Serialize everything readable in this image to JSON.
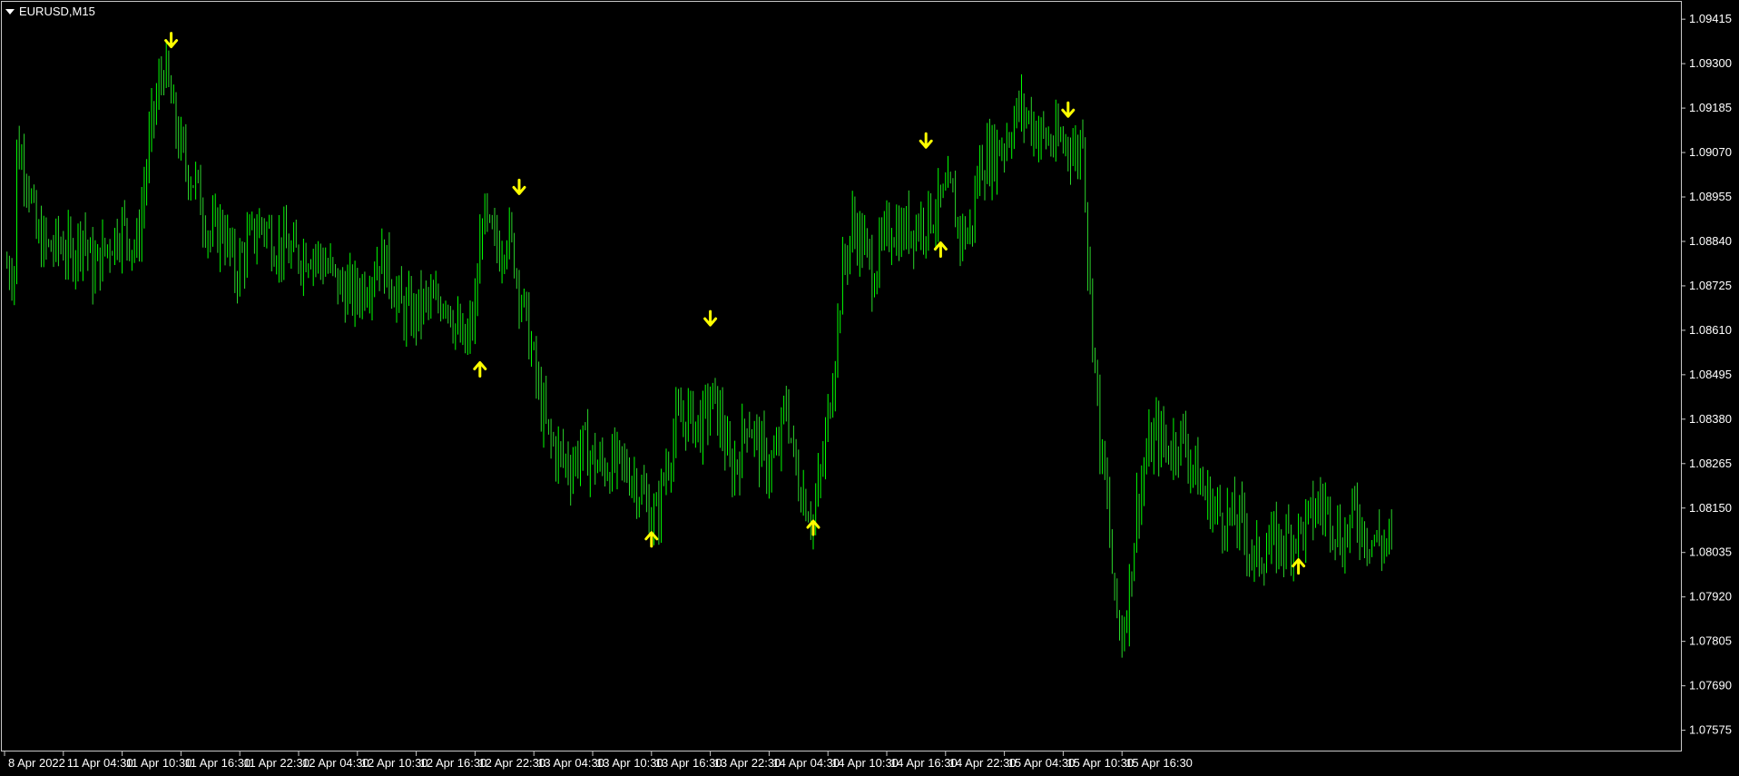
{
  "symbol": {
    "label": "EURUSD,M15",
    "menu_icon": "chevron-down-icon"
  },
  "colors": {
    "background": "#000000",
    "bull": "#00ff00",
    "bear": "#2bd52b",
    "arrow": "#ffff00",
    "axis": "#c8c8c8",
    "text": "#ffffff"
  },
  "chart_data": {
    "type": "candlestick",
    "title": "EURUSD,M15",
    "xlabel": "",
    "ylabel": "",
    "grid": false,
    "ylim": [
      1.0752,
      1.0946
    ],
    "y_ticks": [
      "1.09415",
      "1.09300",
      "1.09185",
      "1.09070",
      "1.08955",
      "1.08840",
      "1.08725",
      "1.08610",
      "1.08495",
      "1.08380",
      "1.08265",
      "1.08150",
      "1.08035",
      "1.07920",
      "1.07805",
      "1.07690",
      "1.07575"
    ],
    "x_ticks": [
      "8 Apr 2022",
      "11 Apr 04:30",
      "11 Apr 10:30",
      "11 Apr 16:30",
      "11 Apr 22:30",
      "12 Apr 04:30",
      "12 Apr 10:30",
      "12 Apr 16:30",
      "12 Apr 22:30",
      "13 Apr 04:30",
      "13 Apr 10:30",
      "13 Apr 16:30",
      "13 Apr 22:30",
      "14 Apr 04:30",
      "14 Apr 10:30",
      "14 Apr 16:30",
      "14 Apr 22:30",
      "15 Apr 04:30",
      "15 Apr 10:30",
      "15 Apr 16:30"
    ],
    "bars_per_tick": 24,
    "close_path": [
      [
        0,
        1.0878
      ],
      [
        4,
        1.0877
      ],
      [
        5,
        1.0908
      ],
      [
        9,
        1.0903
      ],
      [
        13,
        1.0885
      ],
      [
        18,
        1.0882
      ],
      [
        24,
        1.0883
      ],
      [
        27,
        1.088
      ],
      [
        32,
        1.0887
      ],
      [
        36,
        1.0876
      ],
      [
        42,
        1.0883
      ],
      [
        48,
        1.0888
      ],
      [
        54,
        1.0882
      ],
      [
        60,
        1.0914
      ],
      [
        65,
        1.093
      ],
      [
        69,
        1.0916
      ],
      [
        73,
        1.0905
      ],
      [
        78,
        1.0899
      ],
      [
        84,
        1.0885
      ],
      [
        89,
        1.0888
      ],
      [
        94,
        1.0876
      ],
      [
        99,
        1.0883
      ],
      [
        105,
        1.0889
      ],
      [
        110,
        1.0884
      ],
      [
        118,
        1.088
      ],
      [
        125,
        1.0882
      ],
      [
        132,
        1.0877
      ],
      [
        137,
        1.0872
      ],
      [
        143,
        1.087
      ],
      [
        148,
        1.0874
      ],
      [
        153,
        1.088
      ],
      [
        157,
        1.0876
      ],
      [
        162,
        1.0866
      ],
      [
        167,
        1.0865
      ],
      [
        172,
        1.0868
      ],
      [
        176,
        1.0867
      ],
      [
        180,
        1.0871
      ],
      [
        185,
        1.086
      ],
      [
        188,
        1.0856
      ],
      [
        192,
        1.0866
      ],
      [
        195,
        1.0891
      ],
      [
        198,
        1.0885
      ],
      [
        202,
        1.0882
      ],
      [
        205,
        1.0887
      ],
      [
        208,
        1.088
      ],
      [
        212,
        1.0866
      ],
      [
        215,
        1.0856
      ],
      [
        218,
        1.0844
      ],
      [
        222,
        1.0833
      ],
      [
        226,
        1.0829
      ],
      [
        231,
        1.0826
      ],
      [
        236,
        1.0831
      ],
      [
        242,
        1.0826
      ],
      [
        250,
        1.0826
      ],
      [
        256,
        1.0824
      ],
      [
        262,
        1.0816
      ],
      [
        266,
        1.0812
      ],
      [
        270,
        1.0826
      ],
      [
        274,
        1.0836
      ],
      [
        279,
        1.0839
      ],
      [
        284,
        1.0836
      ],
      [
        289,
        1.0843
      ],
      [
        293,
        1.0836
      ],
      [
        296,
        1.0824
      ],
      [
        300,
        1.0829
      ],
      [
        303,
        1.0839
      ],
      [
        307,
        1.0832
      ],
      [
        311,
        1.0826
      ],
      [
        315,
        1.0828
      ],
      [
        319,
        1.0842
      ],
      [
        323,
        1.0824
      ],
      [
        327,
        1.0817
      ],
      [
        330,
        1.0812
      ],
      [
        334,
        1.0827
      ],
      [
        338,
        1.085
      ],
      [
        342,
        1.0876
      ],
      [
        346,
        1.0888
      ],
      [
        350,
        1.0884
      ],
      [
        354,
        1.0876
      ],
      [
        358,
        1.0882
      ],
      [
        362,
        1.0888
      ],
      [
        366,
        1.0886
      ],
      [
        370,
        1.0888
      ],
      [
        374,
        1.0889
      ],
      [
        380,
        1.0892
      ],
      [
        386,
        1.0896
      ],
      [
        390,
        1.0886
      ],
      [
        394,
        1.0886
      ],
      [
        398,
        1.0904
      ],
      [
        402,
        1.0906
      ],
      [
        408,
        1.091
      ],
      [
        414,
        1.0918
      ],
      [
        418,
        1.0916
      ],
      [
        422,
        1.0912
      ],
      [
        428,
        1.0909
      ],
      [
        434,
        1.091
      ],
      [
        438,
        1.0906
      ],
      [
        440,
        1.0915
      ],
      [
        442,
        1.088
      ],
      [
        444,
        1.0862
      ],
      [
        447,
        1.0832
      ],
      [
        450,
        1.0816
      ],
      [
        453,
        1.079
      ],
      [
        456,
        1.0782
      ],
      [
        459,
        1.0795
      ],
      [
        462,
        1.0815
      ],
      [
        466,
        1.0828
      ],
      [
        470,
        1.0834
      ],
      [
        475,
        1.083
      ],
      [
        480,
        1.0834
      ],
      [
        485,
        1.0826
      ],
      [
        490,
        1.0818
      ],
      [
        495,
        1.0814
      ],
      [
        500,
        1.0812
      ],
      [
        505,
        1.0811
      ],
      [
        510,
        1.0801
      ],
      [
        514,
        1.0804
      ],
      [
        520,
        1.0806
      ],
      [
        526,
        1.0808
      ],
      [
        531,
        1.081
      ],
      [
        536,
        1.0816
      ],
      [
        541,
        1.0814
      ],
      [
        546,
        1.0806
      ],
      [
        551,
        1.0814
      ],
      [
        556,
        1.0808
      ],
      [
        561,
        1.0806
      ],
      [
        566,
        1.0806
      ]
    ],
    "signals": [
      {
        "bar": 68,
        "type": "sell",
        "price": 1.0936
      },
      {
        "bar": 194,
        "type": "buy",
        "price": 1.0851
      },
      {
        "bar": 210,
        "type": "sell",
        "price": 1.0898
      },
      {
        "bar": 264,
        "type": "buy",
        "price": 1.0807
      },
      {
        "bar": 288,
        "type": "sell",
        "price": 1.0864
      },
      {
        "bar": 330,
        "type": "buy",
        "price": 1.081
      },
      {
        "bar": 376,
        "type": "sell",
        "price": 1.091
      },
      {
        "bar": 382,
        "type": "buy",
        "price": 1.0882
      },
      {
        "bar": 434,
        "type": "sell",
        "price": 1.0918
      },
      {
        "bar": 528,
        "type": "buy",
        "price": 1.08
      }
    ]
  }
}
